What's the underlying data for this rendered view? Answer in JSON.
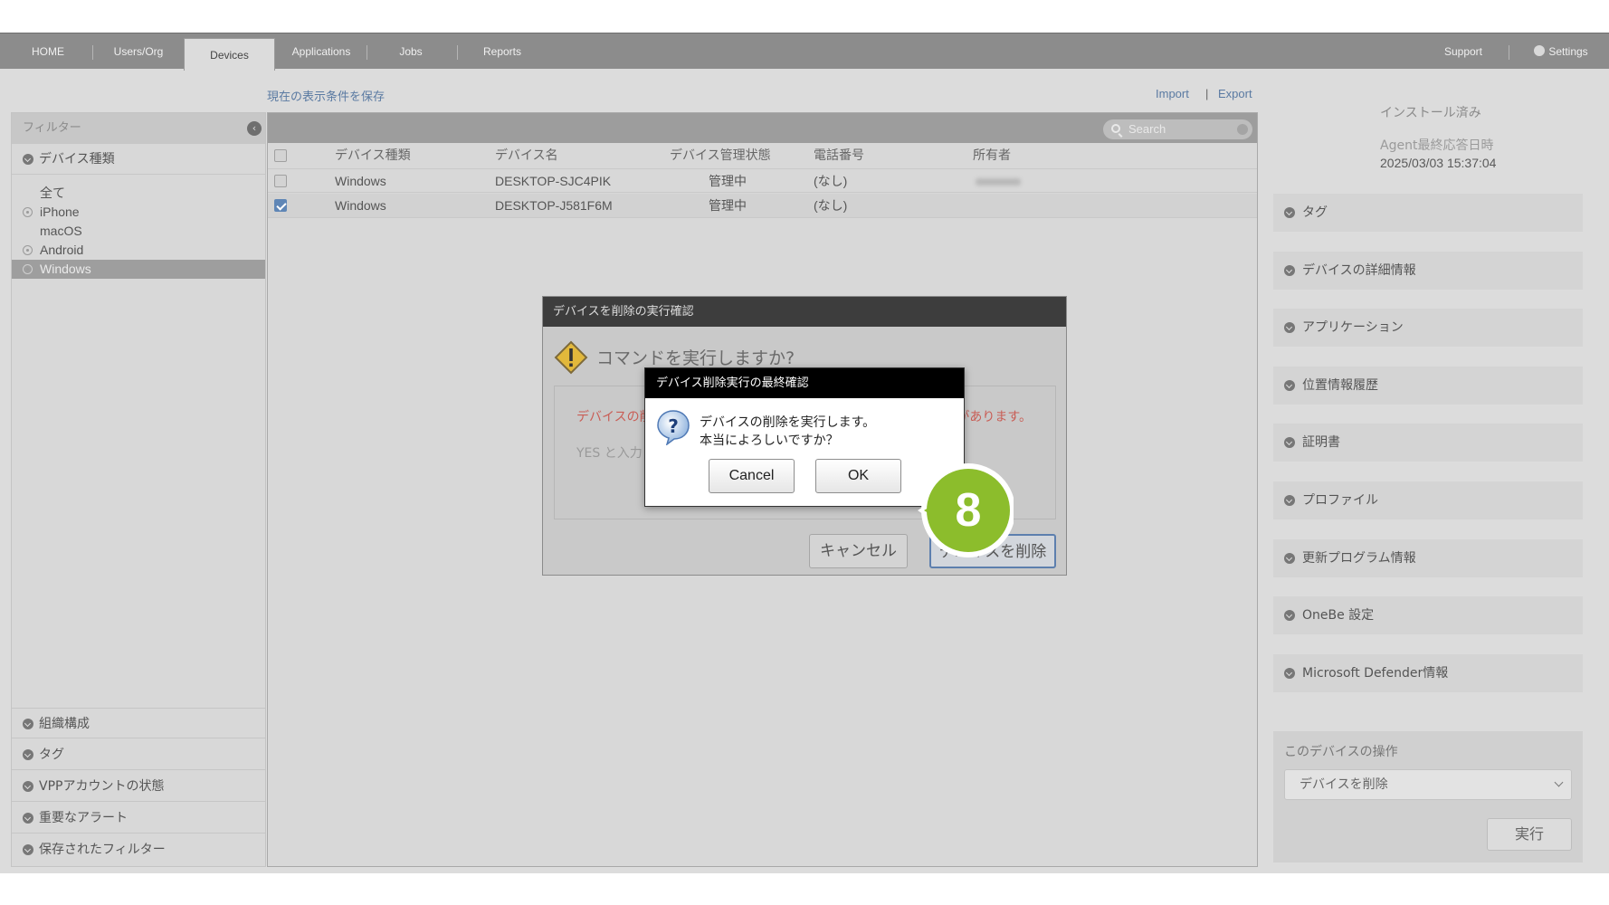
{
  "nav": {
    "tabs": [
      "HOME",
      "Users/Org",
      "Devices",
      "Applications",
      "Jobs",
      "Reports"
    ],
    "active_tab": "Devices",
    "support": "Support",
    "settings": "Settings"
  },
  "toolbar": {
    "save_view": "現在の表示条件を保存",
    "import": "Import",
    "separator": "|",
    "export": "Export"
  },
  "sidebar": {
    "header": "フィルター",
    "device_type": "デバイス種類",
    "items": [
      "全て",
      "iPhone",
      "macOS",
      "Android",
      "Windows"
    ],
    "selected_item": "Windows",
    "bottom_sections": [
      "組織構成",
      "タグ",
      "VPPアカウントの状態",
      "重要なアラート",
      "保存されたフィルター"
    ]
  },
  "table": {
    "search_placeholder": "Search",
    "columns": [
      "デバイス種類",
      "デバイス名",
      "デバイス管理状態",
      "電話番号",
      "所有者"
    ],
    "rows": [
      {
        "type": "Windows",
        "name": "DESKTOP-SJC4PIK",
        "status": "管理中",
        "phone": "(なし)",
        "checked": false
      },
      {
        "type": "Windows",
        "name": "DESKTOP-J581F6M",
        "status": "管理中",
        "phone": "(なし)",
        "checked": true
      }
    ]
  },
  "right_panel": {
    "install_status": "インストール済み",
    "agent_label": "Agent最終応答日時",
    "agent_value": "2025/03/03 15:37:04",
    "sections": [
      "タグ",
      "デバイスの詳細情報",
      "アプリケーション",
      "位置情報履歴",
      "証明書",
      "プロファイル",
      "更新プログラム情報",
      "OneBe 設定",
      "Microsoft Defender情報"
    ],
    "ops_label": "このデバイスの操作",
    "ops_selected": "デバイスを削除",
    "run_button": "実行"
  },
  "dialog1": {
    "title": "デバイスを削除の実行確認",
    "heading": "コマンドを実行しますか?",
    "warning_left": "デバイスの削",
    "warning_right": "があります。",
    "yes_hint": "YES と入力し",
    "cancel": "キャンセル",
    "delete": "デバイスを削除"
  },
  "dialog2": {
    "title": "デバイス削除実行の最終確認",
    "line1": "デバイスの削除を実行します。",
    "line2": "本当によろしいですか？",
    "cancel": "Cancel",
    "ok": "OK"
  },
  "step_badge": "8",
  "colors": {
    "badge_green": "#8cbd2c",
    "link_blue": "#5a7aa2",
    "warning_red": "#c95d55",
    "selected_blue": "#5d7fae"
  }
}
